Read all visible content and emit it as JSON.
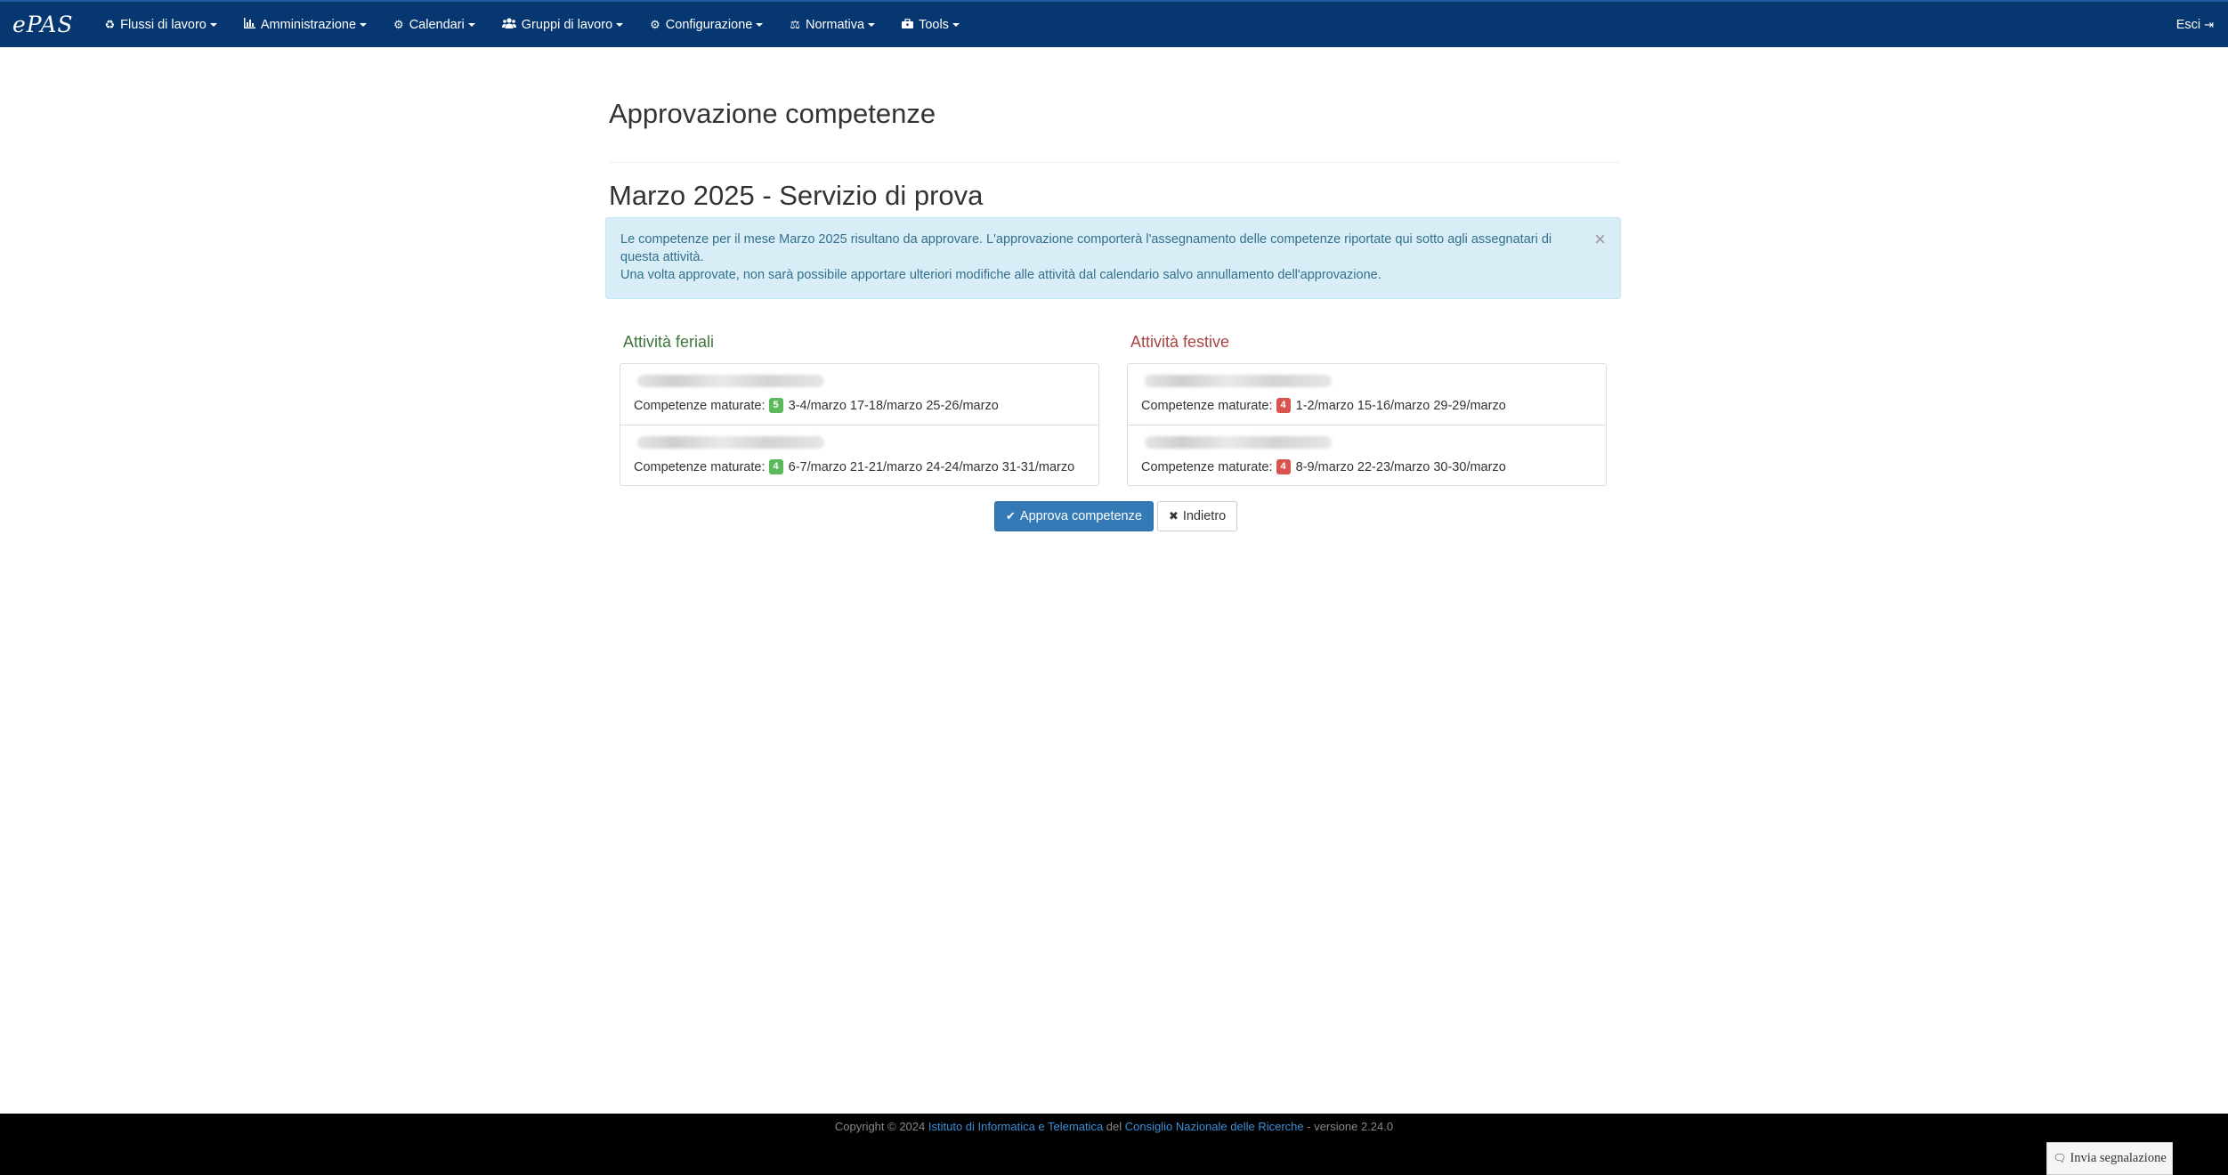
{
  "navbar": {
    "brand": "ePAS",
    "items": [
      {
        "label": "Flussi di lavoro",
        "icon": "recycle-icon"
      },
      {
        "label": "Amministrazione",
        "icon": "bar-chart-icon"
      },
      {
        "label": "Calendari",
        "icon": "gear-icon"
      },
      {
        "label": "Gruppi di lavoro",
        "icon": "users-icon"
      },
      {
        "label": "Configurazione",
        "icon": "gear-icon"
      },
      {
        "label": "Normativa",
        "icon": "balance-scale-icon"
      },
      {
        "label": "Tools",
        "icon": "toolbox-icon"
      }
    ],
    "logout_label": "Esci",
    "bg_color": "#063770"
  },
  "page": {
    "title": "Approvazione competenze",
    "subtitle": "Marzo 2025 - Servizio di prova"
  },
  "alert": {
    "line1": "Le competenze per il mese Marzo 2025 risultano da approvare. L'approvazione comporterà l'assegnamento delle competenze riportate qui sotto agli assegnatari di questa attività.",
    "line2": "Una volta approvate, non sarà possibile apportare ulteriori modifiche alle attività dal calendario salvo annullamento dell'approvazione.",
    "close": "×"
  },
  "feriali": {
    "title": "Attività feriali",
    "rows": [
      {
        "label": "Competenze maturate:",
        "count": "5",
        "dates": "3-4/marzo 17-18/marzo 25-26/marzo"
      },
      {
        "label": "Competenze maturate:",
        "count": "4",
        "dates": "6-7/marzo 21-21/marzo 24-24/marzo 31-31/marzo"
      }
    ]
  },
  "festive": {
    "title": "Attività festive",
    "rows": [
      {
        "label": "Competenze maturate:",
        "count": "4",
        "dates": "1-2/marzo 15-16/marzo 29-29/marzo"
      },
      {
        "label": "Competenze maturate:",
        "count": "4",
        "dates": "8-9/marzo 22-23/marzo 30-30/marzo"
      }
    ]
  },
  "buttons": {
    "approve": "Approva competenze",
    "back": "Indietro"
  },
  "footer": {
    "prefix": "Copyright © 2024 ",
    "link1": "Istituto di Informatica e Telematica",
    "mid": " del ",
    "link2": "Consiglio Nazionale delle Ricerche",
    "suffix": " - versione 2.24.0",
    "report_label": "Invia segnalazione"
  }
}
